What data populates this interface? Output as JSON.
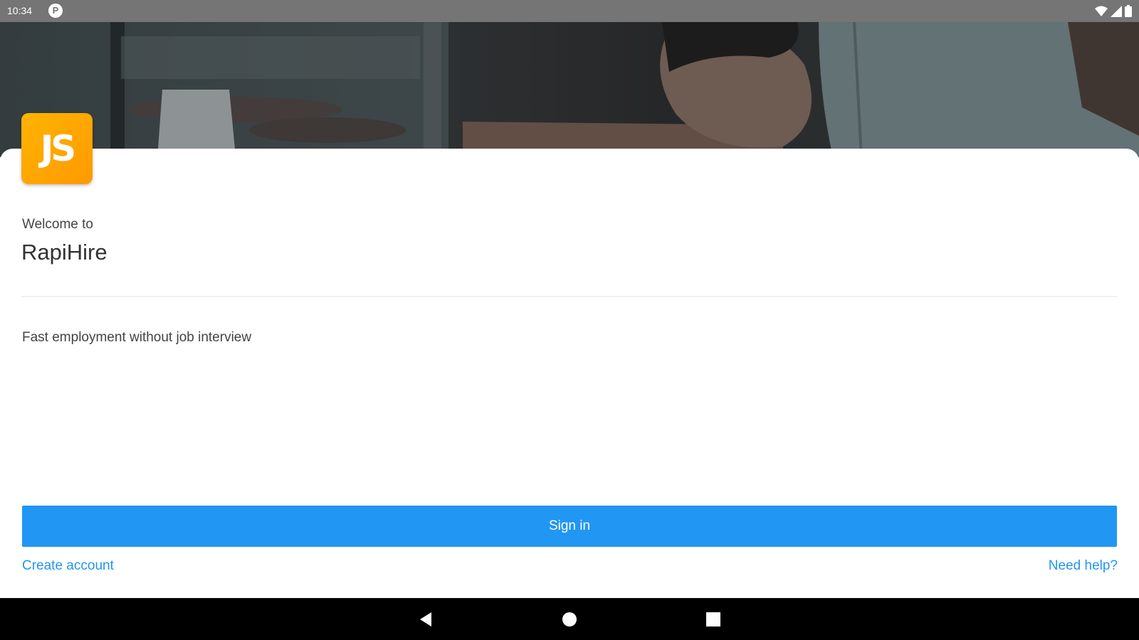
{
  "status_bar": {
    "time": "10:34",
    "notification_badge": "P"
  },
  "app": {
    "welcome": "Welcome to",
    "name": "RapiHire",
    "logo_text": "JS",
    "tagline": "Fast employment without job interview",
    "signin_label": "Sign in",
    "create_account": "Create account",
    "need_help": "Need help?"
  },
  "colors": {
    "accent": "#2196f3",
    "logo": "#ffa400",
    "status_bar": "#757575"
  },
  "icons": {
    "status": [
      "wifi-icon",
      "signal-icon",
      "battery-icon"
    ],
    "nav": [
      "back-icon",
      "home-icon",
      "recents-icon"
    ]
  }
}
